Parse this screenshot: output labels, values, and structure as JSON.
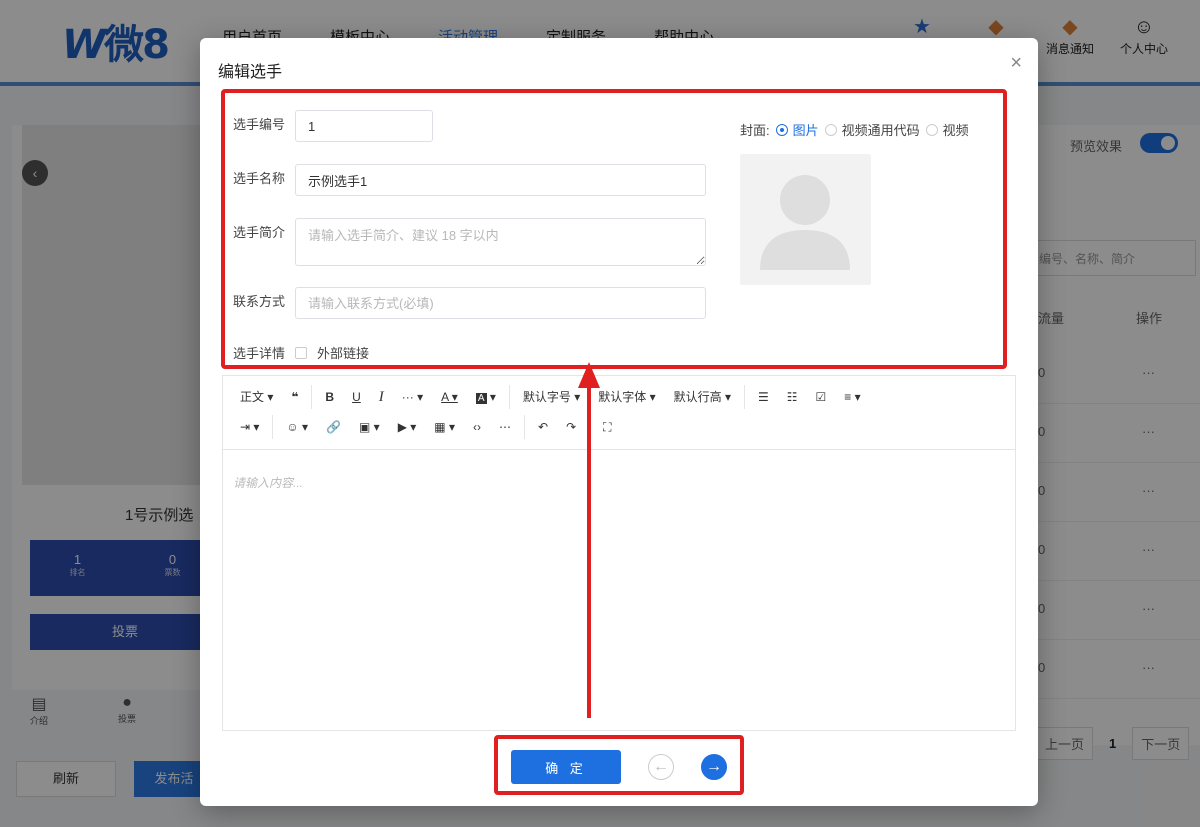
{
  "header": {
    "logo": "微8",
    "nav": [
      "用户首页",
      "模板中心",
      "活动管理",
      "定制服务",
      "帮助中心"
    ],
    "icons": [
      {
        "name": "star-icon",
        "label": ""
      },
      {
        "name": "gem-icon",
        "label": ""
      },
      {
        "name": "message-icon",
        "label": "消息通知"
      },
      {
        "name": "user-icon",
        "label": "个人中心"
      }
    ]
  },
  "background": {
    "player_name": "1号示例选",
    "stats": [
      {
        "value": "1",
        "label": "排名"
      },
      {
        "value": "0",
        "label": "票数"
      }
    ],
    "vote_label": "投票",
    "tabs": [
      {
        "label": "介绍"
      },
      {
        "label": "投票"
      }
    ],
    "refresh_label": "刷新",
    "publish_label": "发布活",
    "preview_label": "预览效果",
    "search_placeholder": "编号、名称、简介",
    "col_count": "流量",
    "col_action": "操作",
    "rows": [
      "0",
      "0",
      "0",
      "0",
      "0",
      "0"
    ],
    "row_action": "···",
    "pager": {
      "prev": "上一页",
      "current": "1",
      "next": "下一页"
    }
  },
  "modal": {
    "title": "编辑选手",
    "close": "×",
    "fields": {
      "number": {
        "label": "选手编号",
        "value": "1"
      },
      "name": {
        "label": "选手名称",
        "value": "示例选手1"
      },
      "intro": {
        "label": "选手简介",
        "placeholder": "请输入选手简介、建议 18 字以内"
      },
      "contact": {
        "label": "联系方式",
        "placeholder": "请输入联系方式(必填)"
      },
      "detail": {
        "label": "选手详情",
        "external_link": "外部链接"
      }
    },
    "cover": {
      "label": "封面:",
      "options": [
        "图片",
        "视频通用代码",
        "视频"
      ],
      "selected": "图片"
    },
    "toolbar": {
      "row1": [
        "正文",
        "❝",
        "B",
        "U",
        "I",
        "···",
        "A",
        "A",
        "默认字号",
        "默认字体",
        "默认行高",
        "☰",
        "☷",
        "☑",
        "≡"
      ],
      "row2": [
        "⇥",
        "☺",
        "🔗",
        "▣",
        "▶",
        "▦",
        "‹›",
        "⋯",
        "↶",
        "↷",
        "⛶"
      ]
    },
    "editor_placeholder": "请输入内容...",
    "ok_label": "确 定"
  },
  "colors": {
    "primary": "#1e6fe0",
    "annotation": "#e02020"
  }
}
